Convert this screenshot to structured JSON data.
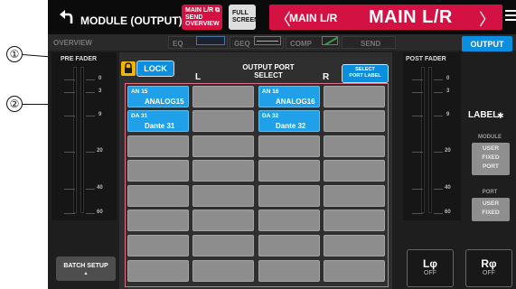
{
  "callouts": [
    "①",
    "②"
  ],
  "titlebar": {
    "title": "MODULE (OUTPUT)",
    "send_overview": [
      "MAIN L/R",
      "SEND",
      "OVERVIEW"
    ],
    "full_screen": [
      "FULL",
      "SCREEN"
    ],
    "channel_small": "MAIN L/R",
    "channel_big": "MAIN L/R",
    "prev": "〈",
    "next": "〉"
  },
  "tabs": {
    "overview": "OVERVIEW",
    "eq": "EQ",
    "geq": "GEQ",
    "comp": "COMP",
    "send": "SEND",
    "output": "OUTPUT"
  },
  "pre_fader": {
    "label": "PRE FADER",
    "scale": [
      "0",
      "3",
      "9",
      "20",
      "40",
      "60"
    ]
  },
  "post_fader": {
    "label": "POST FADER",
    "scale": [
      "0",
      "3",
      "9",
      "20",
      "40",
      "60"
    ]
  },
  "batch_setup": "BATCH SETUP",
  "center": {
    "lock": "LOCK",
    "title_line1": "OUTPUT PORT",
    "title_line2": "SELECT",
    "left": "L",
    "right": "R",
    "select_label_line1": "SELECT",
    "select_label_line2": "PORT LABEL"
  },
  "left_col": {
    "row1": {
      "port": "AN 15",
      "name": "ANALOG15"
    },
    "row2": {
      "port": "DA 31",
      "name": "Dante 31"
    }
  },
  "right_col": {
    "row1": {
      "port": "AN 16",
      "name": "ANALOG16"
    },
    "row2": {
      "port": "DA 32",
      "name": "Dante 32"
    }
  },
  "label_panel": {
    "title": "LABEL",
    "module_title": "MODULE",
    "module_opts": [
      "USER",
      "FIXED",
      "PORT"
    ],
    "port_title": "PORT",
    "port_opts": [
      "USER",
      "FIXED"
    ]
  },
  "phase": {
    "left": "Lφ",
    "right": "Rφ",
    "state": "OFF"
  }
}
